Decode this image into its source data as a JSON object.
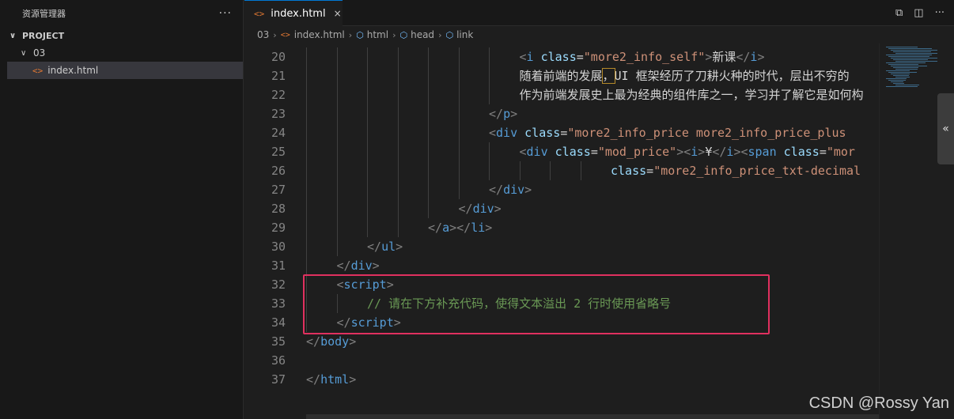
{
  "sidebar": {
    "title": "资源管理器",
    "more": "···",
    "project": "PROJECT",
    "folder": "03",
    "file": "index.html"
  },
  "tabs": [
    {
      "label": "index.html",
      "close": "×"
    }
  ],
  "breadcrumb": [
    "03",
    "index.html",
    "html",
    "head",
    "link"
  ],
  "panel_toggle": "«",
  "watermark": "CSDN @Rossy Yan",
  "code_lines": [
    {
      "n": "20",
      "indent": 7,
      "parts": [
        [
          "pun",
          "<"
        ],
        [
          "tag",
          "i "
        ],
        [
          "attr",
          "class"
        ],
        [
          "txt",
          "="
        ],
        [
          "str",
          "\"more2_info_self\""
        ],
        [
          "pun",
          ">"
        ],
        [
          "txt",
          "新课"
        ],
        [
          "pun",
          "</"
        ],
        [
          "tag",
          "i"
        ],
        [
          "pun",
          ">"
        ]
      ]
    },
    {
      "n": "21",
      "indent": 7,
      "parts": [
        [
          "txt",
          "随着前端的发展"
        ],
        [
          "cur",
          "，"
        ],
        [
          "txt",
          "UI 框架经历了刀耕火种的时代，层出不穷的"
        ]
      ]
    },
    {
      "n": "22",
      "indent": 7,
      "parts": [
        [
          "txt",
          "作为前端发展史上最为经典的组件库之一，学习并了解它是如何构"
        ]
      ]
    },
    {
      "n": "23",
      "indent": 6,
      "parts": [
        [
          "pun",
          "</"
        ],
        [
          "tag",
          "p"
        ],
        [
          "pun",
          ">"
        ]
      ]
    },
    {
      "n": "24",
      "indent": 6,
      "parts": [
        [
          "pun",
          "<"
        ],
        [
          "tag",
          "div "
        ],
        [
          "attr",
          "class"
        ],
        [
          "txt",
          "="
        ],
        [
          "str",
          "\"more2_info_price more2_info_price_plus"
        ]
      ]
    },
    {
      "n": "25",
      "indent": 7,
      "parts": [
        [
          "pun",
          "<"
        ],
        [
          "tag",
          "div "
        ],
        [
          "attr",
          "class"
        ],
        [
          "txt",
          "="
        ],
        [
          "str",
          "\"mod_price\""
        ],
        [
          "pun",
          "><"
        ],
        [
          "tag",
          "i"
        ],
        [
          "pun",
          ">"
        ],
        [
          "txt",
          "¥"
        ],
        [
          "pun",
          "</"
        ],
        [
          "tag",
          "i"
        ],
        [
          "pun",
          "><"
        ],
        [
          "tag",
          "span "
        ],
        [
          "attr",
          "class"
        ],
        [
          "txt",
          "="
        ],
        [
          "str",
          "\"mor"
        ]
      ]
    },
    {
      "n": "26",
      "indent": 10,
      "parts": [
        [
          "attr",
          "class"
        ],
        [
          "txt",
          "="
        ],
        [
          "str",
          "\"more2_info_price_txt-decimal"
        ]
      ]
    },
    {
      "n": "27",
      "indent": 6,
      "parts": [
        [
          "pun",
          "</"
        ],
        [
          "tag",
          "div"
        ],
        [
          "pun",
          ">"
        ]
      ]
    },
    {
      "n": "28",
      "indent": 5,
      "parts": [
        [
          "pun",
          "</"
        ],
        [
          "tag",
          "div"
        ],
        [
          "pun",
          ">"
        ]
      ]
    },
    {
      "n": "29",
      "indent": 4,
      "parts": [
        [
          "pun",
          "</"
        ],
        [
          "tag",
          "a"
        ],
        [
          "pun",
          "></"
        ],
        [
          "tag",
          "li"
        ],
        [
          "pun",
          ">"
        ]
      ]
    },
    {
      "n": "30",
      "indent": 2,
      "parts": [
        [
          "pun",
          "</"
        ],
        [
          "tag",
          "ul"
        ],
        [
          "pun",
          ">"
        ]
      ]
    },
    {
      "n": "31",
      "indent": 1,
      "parts": [
        [
          "pun",
          "</"
        ],
        [
          "tag",
          "div"
        ],
        [
          "pun",
          ">"
        ]
      ]
    },
    {
      "n": "32",
      "indent": 1,
      "parts": [
        [
          "pun",
          "<"
        ],
        [
          "tag",
          "script"
        ],
        [
          "pun",
          ">"
        ]
      ]
    },
    {
      "n": "33",
      "indent": 2,
      "parts": [
        [
          "cmt",
          "// 请在下方补充代码，使得文本溢出 2 行时使用省略号"
        ]
      ]
    },
    {
      "n": "34",
      "indent": 1,
      "parts": [
        [
          "pun",
          "</"
        ],
        [
          "tag",
          "script"
        ],
        [
          "pun",
          ">"
        ]
      ]
    },
    {
      "n": "35",
      "indent": 0,
      "parts": [
        [
          "pun",
          "</"
        ],
        [
          "tag",
          "body"
        ],
        [
          "pun",
          ">"
        ]
      ]
    },
    {
      "n": "36",
      "indent": 0,
      "parts": []
    },
    {
      "n": "37",
      "indent": 0,
      "parts": [
        [
          "pun",
          "</"
        ],
        [
          "tag",
          "html"
        ],
        [
          "pun",
          ">"
        ]
      ]
    }
  ]
}
